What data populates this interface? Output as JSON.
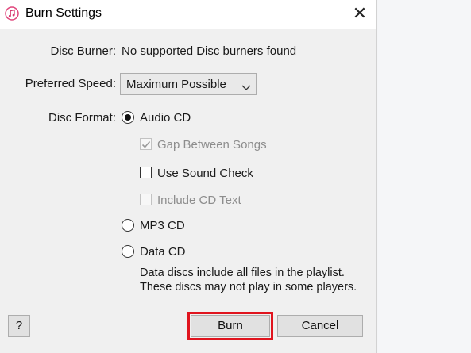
{
  "window": {
    "title": "Burn Settings",
    "close_glyph": "✕",
    "app_icon": "itunes-music-note-icon"
  },
  "disc_burner": {
    "label": "Disc Burner:",
    "value": "No supported Disc burners found"
  },
  "preferred_speed": {
    "label": "Preferred Speed:",
    "selected": "Maximum Possible"
  },
  "disc_format": {
    "label": "Disc Format:",
    "options": [
      {
        "label": "Audio CD",
        "selected": true
      },
      {
        "label": "MP3 CD",
        "selected": false
      },
      {
        "label": "Data CD",
        "selected": false
      }
    ],
    "audio_cd_options": [
      {
        "label": "Gap Between Songs",
        "checked": true,
        "enabled": false
      },
      {
        "label": "Use Sound Check",
        "checked": false,
        "enabled": true
      },
      {
        "label": "Include CD Text",
        "checked": false,
        "enabled": false
      }
    ],
    "data_cd_note": [
      "Data discs include all files in the playlist.",
      "These discs may not play in some players."
    ]
  },
  "buttons": {
    "help": "?",
    "burn": "Burn",
    "cancel": "Cancel"
  },
  "colors": {
    "highlight": "#e0141e",
    "dialog_bg": "#f0f0f0",
    "titlebar_bg": "#ffffff"
  }
}
